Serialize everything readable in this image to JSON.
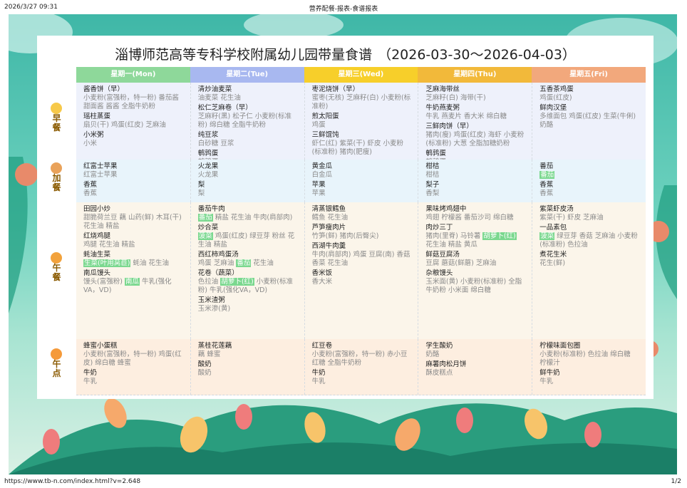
{
  "browser": {
    "datetime": "2026/3/27 09:31",
    "page_title": "营养配餐-报表-食谱报表",
    "url": "https://www.tb-n.com/index.html?v=2.648",
    "page_number": "1/2"
  },
  "menu": {
    "title": "淄博师范高等专科学校附属幼儿园带量食谱",
    "date_range": "（2026-03-30～2026-04-03）",
    "days": [
      {
        "label": "星期一(Mon)",
        "color": "#8ed89a"
      },
      {
        "label": "星期二(Tue)",
        "color": "#a8b8f0"
      },
      {
        "label": "星期三(Wed)",
        "color": "#f7cf2a"
      },
      {
        "label": "星期四(Thu)",
        "color": "#f2b93a"
      },
      {
        "label": "星期五(Fri)",
        "color": "#f2a87c"
      }
    ],
    "meals": [
      {
        "name": "早餐",
        "icon_name": "egg-icon",
        "row_color": "#eef1fb",
        "cells": [
          [
            {
              "dish": "酱香饼（早）",
              "ingredients": [
                {
                  "t": "小麦粉(富强粉，特一粉) 番茄酱 甜面酱 酱酱 全脂牛奶粉"
                }
              ]
            },
            {
              "dish": "瑶柱蒸蛋",
              "ingredients": [
                {
                  "t": "扇贝(干) 鸡蛋(红皮) 芝麻油"
                }
              ]
            },
            {
              "dish": "小米粥",
              "ingredients": [
                {
                  "t": "小米"
                }
              ]
            }
          ],
          [
            {
              "dish": "清炒油麦菜",
              "ingredients": [
                {
                  "t": "油麦菜 花生油"
                }
              ]
            },
            {
              "dish": "松仁芝麻卷（早）",
              "ingredients": [
                {
                  "t": "芝麻籽(黑) 松子仁 小麦粉(标准粉) 绵白糖 全脂牛奶粉"
                }
              ]
            },
            {
              "dish": "纯豆浆",
              "ingredients": [
                {
                  "t": "白砂糖 豆浆"
                }
              ]
            },
            {
              "dish": "鹌鹑蛋",
              "ingredients": [
                {
                  "t": "鹌鹑蛋"
                }
              ]
            }
          ],
          [
            {
              "dish": "枣泥烧饼（早）",
              "ingredients": [
                {
                  "t": "蜜枣(无核) 芝麻籽(白) 小麦粉(标准粉)"
                }
              ]
            },
            {
              "dish": "煎太阳蛋",
              "ingredients": [
                {
                  "t": "鸡蛋"
                }
              ]
            },
            {
              "dish": "三鲜馄饨",
              "ingredients": [
                {
                  "t": "虾仁(红) 紫菜(干) 虾皮 小麦粉(标准粉) 猪肉(肥瘦)"
                }
              ]
            }
          ],
          [
            {
              "dish": "芝麻海带丝",
              "ingredients": [
                {
                  "t": "芝麻籽(白) 海带(干)"
                }
              ]
            },
            {
              "dish": "牛奶燕麦粥",
              "ingredients": [
                {
                  "t": "牛乳 燕麦片 香大米 绵白糖"
                }
              ]
            },
            {
              "dish": "三鲜肉饼（早）",
              "ingredients": [
                {
                  "t": "猪肉(瘦) 鸡蛋(红皮) 海虾 小麦粉(标准粉) 大葱 全脂加糖奶粉"
                }
              ]
            },
            {
              "dish": "鹌鹑蛋",
              "ingredients": [
                {
                  "t": "鹌鹑蛋"
                }
              ]
            }
          ],
          [
            {
              "dish": "五香茶鸡蛋",
              "ingredients": [
                {
                  "t": "鸡蛋(红皮)"
                }
              ]
            },
            {
              "dish": "鲜肉汉堡",
              "ingredients": [
                {
                  "t": "多维面包 鸡蛋(红皮) 生菜(牛俐) 奶酪"
                }
              ]
            }
          ]
        ]
      },
      {
        "name": "加餐",
        "icon_name": "bread-icon",
        "row_color": "#e8f4fb",
        "cells": [
          [
            {
              "dish": "红富士苹果",
              "ingredients": [
                {
                  "t": "红富士苹果"
                }
              ]
            },
            {
              "dish": "香蕉",
              "ingredients": [
                {
                  "t": "香蕉"
                }
              ]
            }
          ],
          [
            {
              "dish": "火龙果",
              "ingredients": [
                {
                  "t": "火龙果"
                }
              ]
            },
            {
              "dish": "梨",
              "ingredients": [
                {
                  "t": "梨"
                }
              ]
            }
          ],
          [
            {
              "dish": "黄金瓜",
              "ingredients": [
                {
                  "t": "白金瓜"
                }
              ]
            },
            {
              "dish": "苹果",
              "ingredients": [
                {
                  "t": "苹果"
                }
              ]
            }
          ],
          [
            {
              "dish": "柑桔",
              "ingredients": [
                {
                  "t": "柑桔"
                }
              ]
            },
            {
              "dish": "梨子",
              "ingredients": [
                {
                  "t": "香梨"
                }
              ]
            }
          ],
          [
            {
              "dish": "番茄",
              "ingredients": [
                {
                  "t": "番茄",
                  "hl": true
                }
              ]
            },
            {
              "dish": "香蕉",
              "ingredients": [
                {
                  "t": "香蕉"
                }
              ]
            }
          ]
        ]
      },
      {
        "name": "午餐",
        "icon_name": "bowl-icon",
        "row_color": "#fbf5ea",
        "cells": [
          [
            {
              "dish": "田园小炒",
              "ingredients": [
                {
                  "t": "甜脆荷兰豆 藕 山药(鲜) 木耳(干) 花生油 精盐"
                }
              ]
            },
            {
              "dish": "红烧鸡腿",
              "ingredients": [
                {
                  "t": "鸡腿 花生油 精盐"
                }
              ]
            },
            {
              "dish": "蚝油生菜",
              "ingredients": [
                {
                  "t": "生菜(叶用莴苣)",
                  "hl": true
                },
                {
                  "t": " 蚝油 花生油"
                }
              ]
            },
            {
              "dish": "南瓜馒头",
              "ingredients": [
                {
                  "t": "馒头(富强粉) "
                },
                {
                  "t": "南瓜",
                  "hl": true
                },
                {
                  "t": " 牛乳(强化VA，VD)"
                }
              ]
            }
          ],
          [
            {
              "dish": "番茄牛肉",
              "ingredients": [
                {
                  "t": "番茄",
                  "hl": true
                },
                {
                  "t": " 精盐 花生油 牛肉(肩部肉)"
                }
              ]
            },
            {
              "dish": "炒合菜",
              "ingredients": [
                {
                  "t": "菠菜",
                  "hl": true
                },
                {
                  "t": " 鸡蛋(红皮) 绿豆芽 粉丝 花生油 精盐"
                }
              ]
            },
            {
              "dish": "西红柿鸡蛋汤",
              "ingredients": [
                {
                  "t": "鸡蛋 芝麻油 "
                },
                {
                  "t": "番茄",
                  "hl": true
                },
                {
                  "t": " 花生油"
                }
              ]
            },
            {
              "dish": "花卷（蔬菜）",
              "ingredients": [
                {
                  "t": "色拉油 "
                },
                {
                  "t": "胡萝卜(红)",
                  "hl": true
                },
                {
                  "t": " 小麦粉(标准粉) 牛乳(强化VA，VD)"
                }
              ]
            },
            {
              "dish": "玉米渣粥",
              "ingredients": [
                {
                  "t": "玉米渗(黄)"
                }
              ]
            }
          ],
          [
            {
              "dish": "清蒸银鳕鱼",
              "ingredients": [
                {
                  "t": "鳕鱼 花生油"
                }
              ]
            },
            {
              "dish": "芦笋瘦肉片",
              "ingredients": [
                {
                  "t": "竹笋(鲜) 猪肉(后臀尖)"
                }
              ]
            },
            {
              "dish": "西湖牛肉羹",
              "ingredients": [
                {
                  "t": "牛肉(肩部肉) 鸡蛋 豆腐(南) 香菇 香菜 花生油"
                }
              ]
            },
            {
              "dish": "香米饭",
              "ingredients": [
                {
                  "t": "香大米"
                }
              ]
            }
          ],
          [
            {
              "dish": "果味烤鸡翅中",
              "ingredients": [
                {
                  "t": "鸡翅 柠檬酱 番茄沙司 绵白糖"
                }
              ]
            },
            {
              "dish": "肉炒三丁",
              "ingredients": [
                {
                  "t": "猪肉(里脊) 马铃薯 "
                },
                {
                  "t": "胡萝卜(红)",
                  "hl": true
                },
                {
                  "t": " 花生油 精盐 黄瓜"
                }
              ]
            },
            {
              "dish": "鲜菇豆腐汤",
              "ingredients": [
                {
                  "t": "豆腐 蘑菇(鲜蘑) 芝麻油"
                }
              ]
            },
            {
              "dish": "杂粮馒头",
              "ingredients": [
                {
                  "t": "玉米面(黄) 小麦粉(标准粉) 全脂牛奶粉 小米面 绵白糖"
                }
              ]
            }
          ],
          [
            {
              "dish": "紫菜虾皮汤",
              "ingredients": [
                {
                  "t": "紫菜(干) 虾皮 芝麻油"
                }
              ]
            },
            {
              "dish": "一品素包",
              "ingredients": [
                {
                  "t": "菠菜",
                  "hl": true
                },
                {
                  "t": " 绿豆芽 香菇 芝麻油 小麦粉(标准粉) 色拉油"
                }
              ]
            },
            {
              "dish": "煮花生米",
              "ingredients": [
                {
                  "t": "花生(鲜)"
                }
              ]
            }
          ]
        ]
      },
      {
        "name": "午点",
        "icon_name": "orange-icon",
        "row_color": "#fdeee0",
        "cells": [
          [
            {
              "dish": "蜂蜜小蛋糕",
              "ingredients": [
                {
                  "t": "小麦粉(富强粉，特一粉) 鸡蛋(红皮) 绵白糖 蜂蜜"
                }
              ]
            },
            {
              "dish": "牛奶",
              "ingredients": [
                {
                  "t": "牛乳"
                }
              ]
            }
          ],
          [
            {
              "dish": "蒸桂花莲藕",
              "ingredients": [
                {
                  "t": "藕 蜂蜜"
                }
              ]
            },
            {
              "dish": "酸奶",
              "ingredients": [
                {
                  "t": "酸奶"
                }
              ]
            }
          ],
          [
            {
              "dish": "红豆卷",
              "ingredients": [
                {
                  "t": "小麦粉(富强粉，特一粉) 赤小豆 红糖 全脂牛奶粉"
                }
              ]
            },
            {
              "dish": "牛奶",
              "ingredients": [
                {
                  "t": "牛乳"
                }
              ]
            }
          ],
          [
            {
              "dish": "学生酸奶",
              "ingredients": [
                {
                  "t": "奶酪"
                }
              ]
            },
            {
              "dish": "麻薯肉松月饼",
              "ingredients": [
                {
                  "t": "酥皮糕点"
                }
              ]
            }
          ],
          [
            {
              "dish": "柠檬味面包圈",
              "ingredients": [
                {
                  "t": "小麦粉(标准粉) 色拉油 绵白糖 柠檬汁"
                }
              ]
            },
            {
              "dish": "鲜牛奶",
              "ingredients": [
                {
                  "t": "牛乳"
                }
              ]
            }
          ]
        ]
      }
    ]
  }
}
